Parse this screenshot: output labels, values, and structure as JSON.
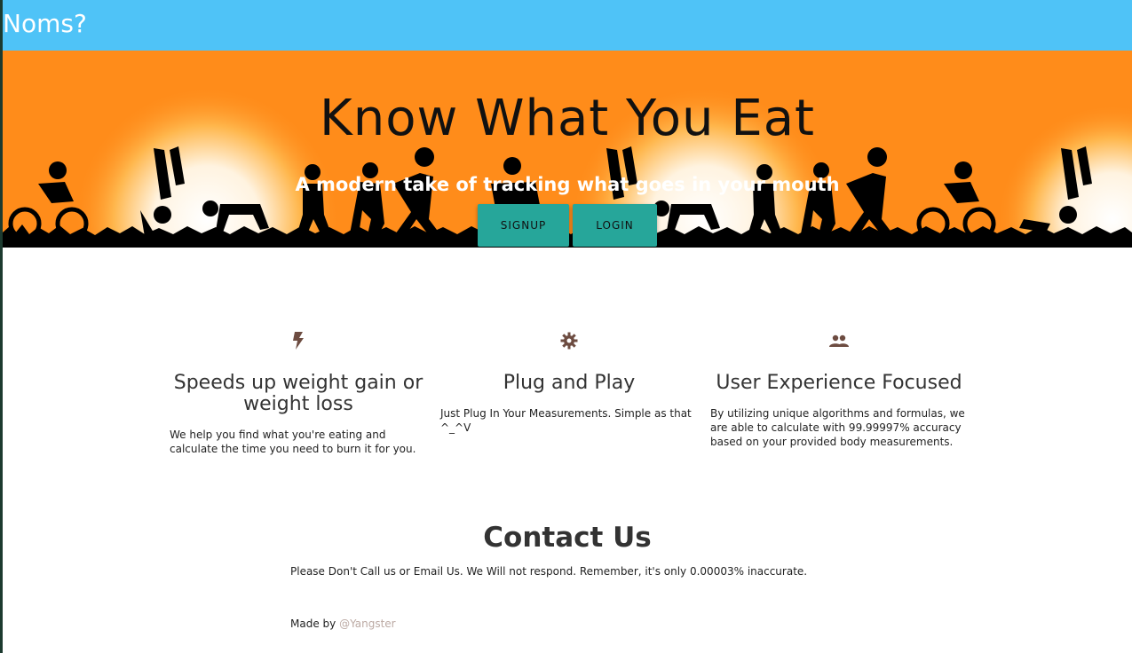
{
  "nav": {
    "brand": "Noms?"
  },
  "hero": {
    "title": "Know What You Eat",
    "subtitle": "A modern take of tracking what goes in your mouth",
    "signup_label": "SIGNUP",
    "login_label": "LOGIN"
  },
  "features": [
    {
      "icon": "flash-icon",
      "title": "Speeds up weight gain or weight loss",
      "text": "We help you find what you're eating and calculate the time you need to burn it for you."
    },
    {
      "icon": "gear-icon",
      "title": "Plug and Play",
      "text": "Just Plug In Your Measurements. Simple as that ^_^V"
    },
    {
      "icon": "group-icon",
      "title": "User Experience Focused",
      "text": "By utilizing unique algorithms and formulas, we are able to calculate with 99.99997% accuracy based on your provided body measurements."
    }
  ],
  "contact": {
    "title": "Contact Us",
    "text": "Please Don't Call us or Email Us. We Will not respond. Remember, it's only 0.00003% inaccurate.",
    "made_by": "Made by",
    "author": "@Yangster"
  },
  "colors": {
    "nav": "#4fc3f7",
    "hero_bg": "#ff8c1a",
    "button": "#26a69a",
    "icon": "#6d4c41",
    "link": "#bcaaa4"
  }
}
